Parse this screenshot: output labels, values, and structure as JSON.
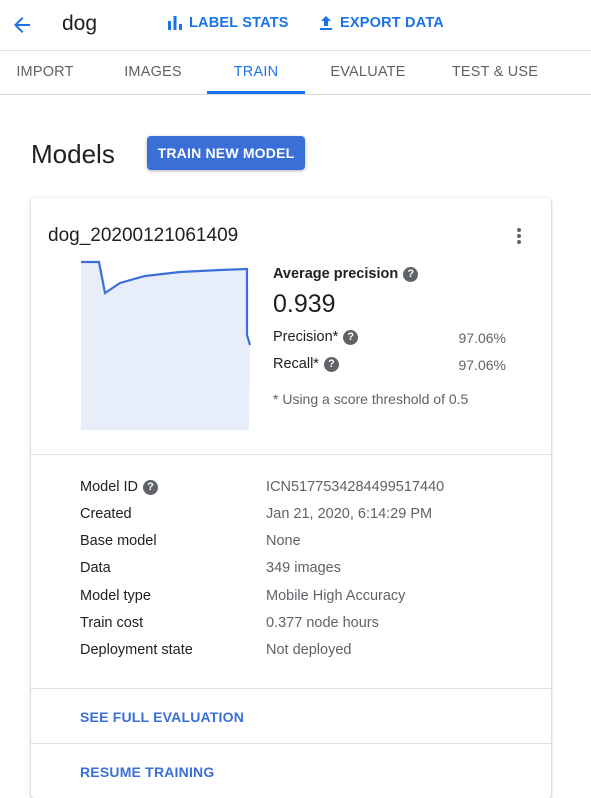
{
  "header": {
    "dataset_name": "dog",
    "label_stats": "LABEL STATS",
    "export_data": "EXPORT DATA"
  },
  "tabs": [
    {
      "label": "IMPORT"
    },
    {
      "label": "IMAGES"
    },
    {
      "label": "TRAIN",
      "active": true
    },
    {
      "label": "EVALUATE"
    },
    {
      "label": "TEST & USE"
    }
  ],
  "page": {
    "title": "Models",
    "train_button": "TRAIN NEW MODEL"
  },
  "model": {
    "name": "dog_20200121061409",
    "average_precision_label": "Average precision",
    "average_precision_value": "0.939",
    "precision_label": "Precision*",
    "precision_value": "97.06%",
    "recall_label": "Recall*",
    "recall_value": "97.06%",
    "threshold_note": "* Using a score threshold of 0.5",
    "details": [
      {
        "label": "Model ID",
        "value": "ICN5177534284499517440"
      },
      {
        "label": "Created",
        "value": "Jan 21, 2020, 6:14:29 PM"
      },
      {
        "label": "Base model",
        "value": "None"
      },
      {
        "label": "Data",
        "value": "349 images"
      },
      {
        "label": "Model type",
        "value": "Mobile High Accuracy"
      },
      {
        "label": "Train cost",
        "value": "0.377 node hours"
      },
      {
        "label": "Deployment state",
        "value": "Not deployed"
      }
    ],
    "see_full_evaluation": "SEE FULL EVALUATION",
    "resume_training": "RESUME TRAINING"
  },
  "colors": {
    "accent": "#1a73e8",
    "button": "#3b6fd8",
    "chart_line": "#3b6fd8",
    "chart_fill": "#e8eef9"
  },
  "icons": {
    "back": "arrow-left-icon",
    "label_stats": "bar-chart-icon",
    "export_data": "upload-icon",
    "menu": "more-vert-icon",
    "help": "help-circle-icon"
  }
}
